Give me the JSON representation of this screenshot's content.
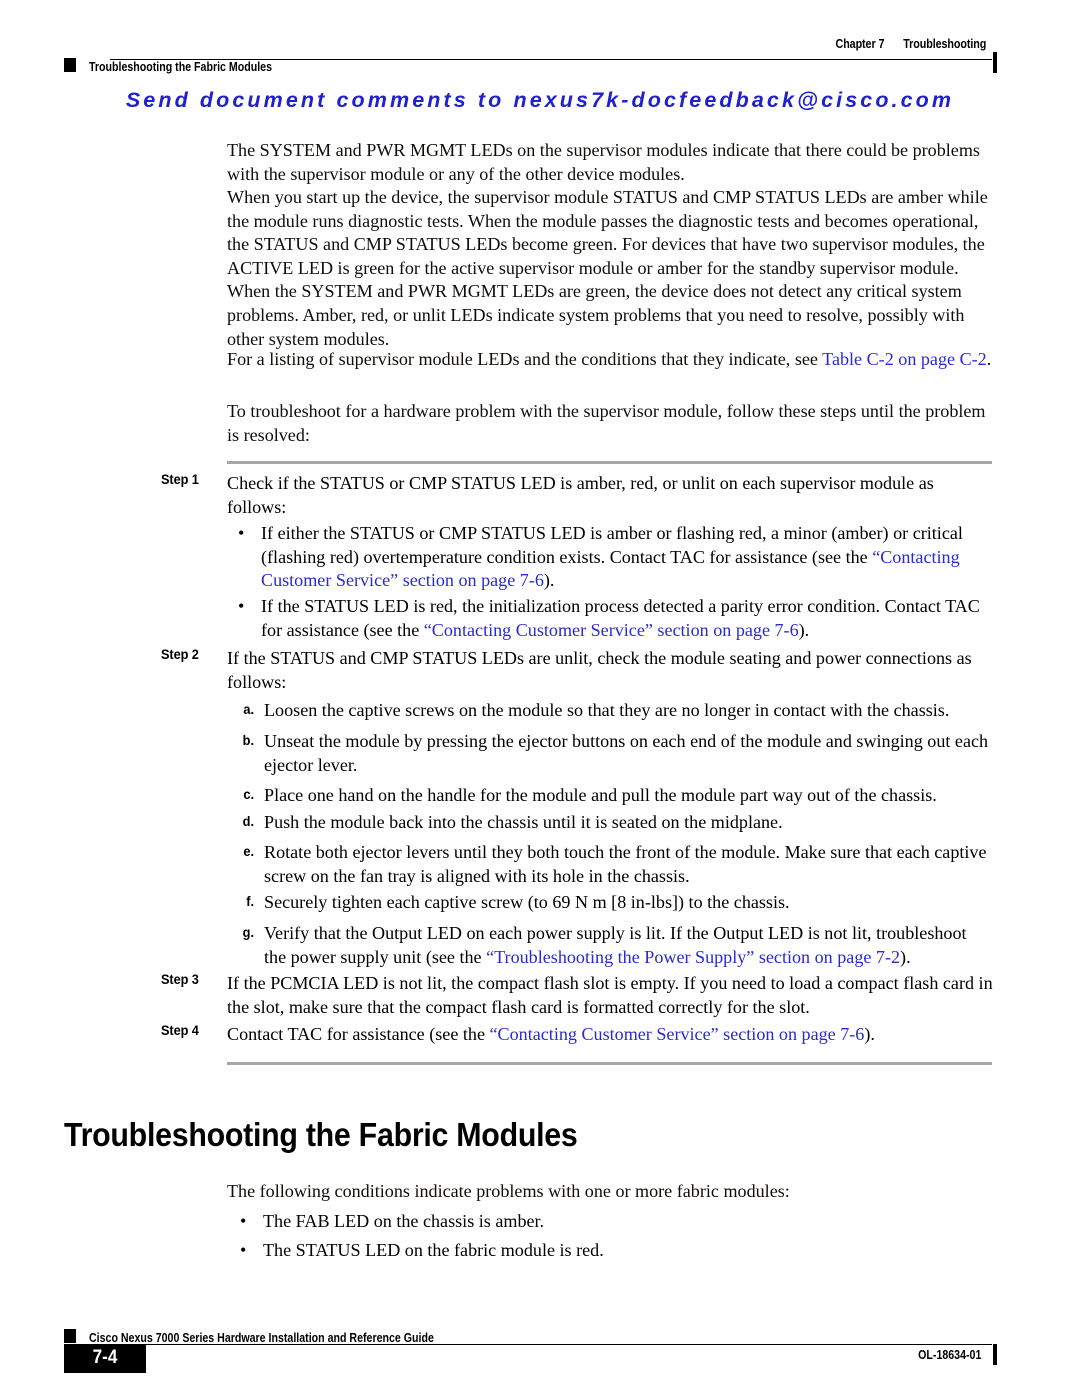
{
  "header": {
    "chapter_label": "Chapter 7",
    "chapter_title": "Troubleshooting",
    "running_title": "Troubleshooting the Fabric Modules"
  },
  "feedback_banner": {
    "text": "Send document comments to nexus7k-docfeedback@cisco.com",
    "color": "#2020cf"
  },
  "body": {
    "p1": "The SYSTEM and PWR MGMT LEDs on the supervisor modules indicate that there could be problems with the supervisor module or any of the other device modules.",
    "p2": "When you start up the device, the supervisor module STATUS and CMP STATUS LEDs are amber while the module runs diagnostic tests. When the module passes the diagnostic tests and becomes operational, the STATUS and CMP STATUS LEDs become green. For devices that have two supervisor modules, the ACTIVE LED is green for the active supervisor module or amber for the standby supervisor module. When the SYSTEM and PWR MGMT LEDs are green, the device does not detect any critical system problems. Amber, red, or unlit LEDs indicate system problems that you need to resolve, possibly with other system modules.",
    "p3_pre": "For a listing of supervisor module LEDs and the conditions that they indicate, see ",
    "p3_link": "Table C-2 on page C-2",
    "p3_post": ".",
    "p4": "To troubleshoot for a hardware problem with the supervisor module, follow these steps until the problem is resolved:"
  },
  "procedure": {
    "steps": [
      {
        "label": "Step 1",
        "text": "Check if the STATUS or CMP STATUS LED is amber, red, or unlit on each supervisor module as follows:"
      },
      {
        "label": "Step 2",
        "text": "If the STATUS and CMP STATUS LEDs are unlit, check the module seating and power connections as follows:"
      },
      {
        "label": "Step 3",
        "text": "If the PCMCIA LED is not lit, the compact flash slot is empty. If you need to load a compact flash card in the slot, make sure that the compact flash card is formatted correctly for the slot."
      },
      {
        "label": "Step 4",
        "pre": "Contact TAC for assistance (see the ",
        "link": "“Contacting Customer Service” section on page 7-6",
        "post": ")."
      }
    ],
    "step1_bullets": [
      {
        "mark": "•",
        "pre": "If either the STATUS or CMP STATUS LED is amber or flashing red, a minor (amber) or critical (flashing red) overtemperature condition exists. Contact TAC for assistance (see the ",
        "link": "“Contacting Customer Service” section on page 7-6",
        "post": ")."
      },
      {
        "mark": "•",
        "pre": "If the STATUS LED is red, the initialization process detected a parity error condition. Contact TAC for assistance (see the ",
        "link": "“Contacting Customer Service” section on page 7-6",
        "post": ")."
      }
    ],
    "step2_substeps": [
      {
        "mark": "a.",
        "text": "Loosen the captive screws on the module so that they are no longer in contact with the chassis."
      },
      {
        "mark": "b.",
        "text": "Unseat the module by pressing the ejector buttons on each end of the module and swinging out each ejector lever."
      },
      {
        "mark": "c.",
        "text": "Place one hand on the handle for the module and pull the module part way out of the chassis."
      },
      {
        "mark": "d.",
        "text": "Push the module back into the chassis until it is seated on the midplane."
      },
      {
        "mark": "e.",
        "text": "Rotate both ejector levers until they both touch the front of the module. Make sure that each captive screw on the fan tray is aligned with its hole in the chassis."
      },
      {
        "mark": "f.",
        "text": "Securely tighten each captive screw (to 69 N m [8 in-lbs]) to the chassis."
      },
      {
        "mark": "g.",
        "pre": "Verify that the Output LED on each power supply is lit. If the Output LED is not lit, troubleshoot the power supply unit (see the ",
        "link": "“Troubleshooting the Power Supply” section on page 7-2",
        "post": ")."
      }
    ]
  },
  "section": {
    "heading": "Troubleshooting the Fabric Modules",
    "intro": "The following conditions indicate problems with one or more fabric modules:",
    "bullets": [
      {
        "mark": "•",
        "text": "The FAB LED on the chassis is amber."
      },
      {
        "mark": "•",
        "text": "The STATUS LED on the fabric module is red."
      }
    ]
  },
  "footer": {
    "guide_title": "Cisco Nexus 7000 Series Hardware Installation and Reference Guide",
    "page_number": "7-4",
    "doc_id": "OL-18634-01"
  }
}
